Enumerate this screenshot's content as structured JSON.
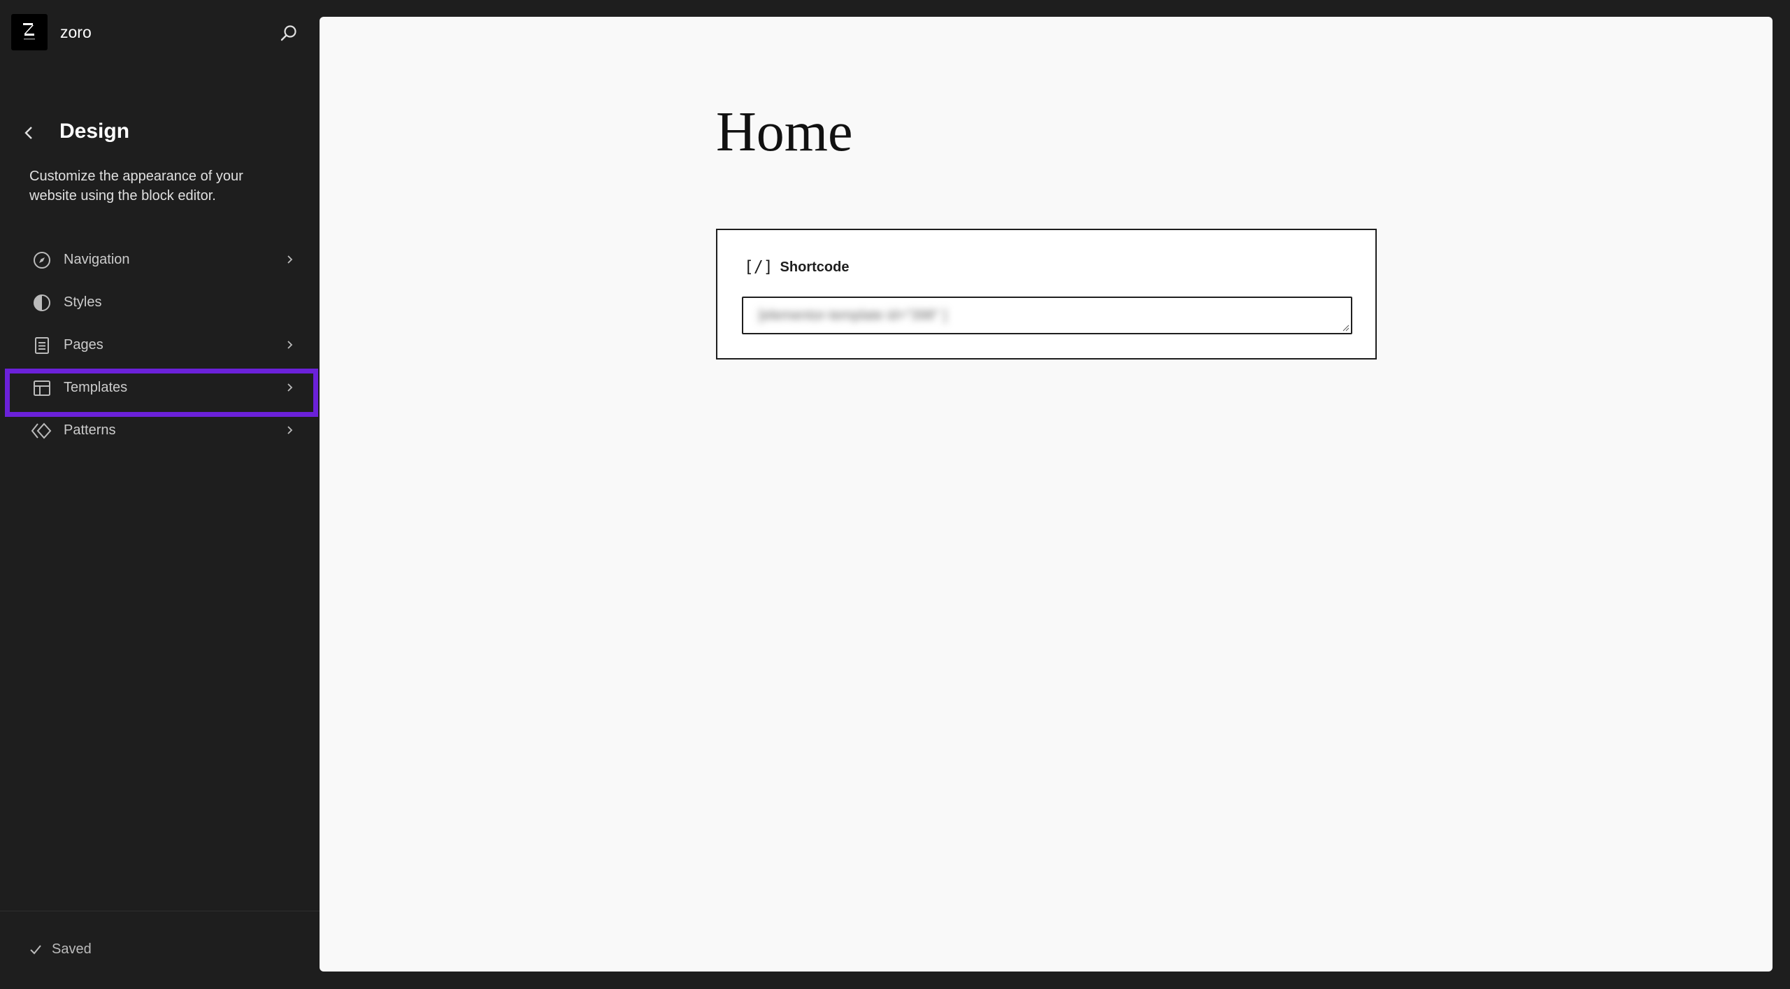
{
  "site": {
    "name": "zoro",
    "logo_icon": "site-logo"
  },
  "panel": {
    "title": "Design",
    "description": "Customize the appearance of your website using the block editor."
  },
  "nav": {
    "items": [
      {
        "label": "Navigation",
        "icon": "compass-icon",
        "has_chevron": true
      },
      {
        "label": "Styles",
        "icon": "half-circle-icon",
        "has_chevron": false
      },
      {
        "label": "Pages",
        "icon": "page-icon",
        "has_chevron": true
      },
      {
        "label": "Templates",
        "icon": "layout-icon",
        "has_chevron": true,
        "highlighted": true
      },
      {
        "label": "Patterns",
        "icon": "diamond-icon",
        "has_chevron": true
      }
    ]
  },
  "footer": {
    "status": "Saved"
  },
  "canvas": {
    "page_title": "Home",
    "block": {
      "icon_text": "[/]",
      "label": "Shortcode",
      "value": "[elementor-template id=\"398\" ]"
    }
  },
  "colors": {
    "annotation": "#6b21d9",
    "sidebar_bg": "#1e1e1e",
    "canvas_bg": "#f9f9f9"
  }
}
